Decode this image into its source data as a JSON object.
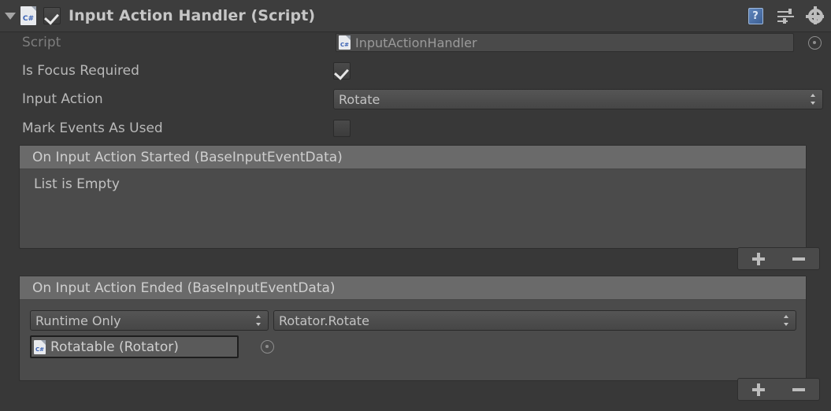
{
  "header": {
    "foldout_icon": "triangle-down-icon",
    "script_type_icon": "csharp-file-icon",
    "enabled": true,
    "title": "Input Action Handler (Script)",
    "icons": {
      "help": "help-book-icon",
      "presets": "preset-sliders-icon",
      "settings": "gear-icon",
      "help_glyph": "?"
    }
  },
  "properties": [
    {
      "label": "Script",
      "type": "object",
      "value": "InputActionHandler",
      "icon": "csharp-file-icon",
      "picker": "object-picker-icon",
      "disabled": true
    },
    {
      "label": "Is Focus Required",
      "type": "checkbox",
      "checked": true
    },
    {
      "label": "Input Action",
      "type": "dropdown",
      "value": "Rotate"
    },
    {
      "label": "Mark Events As Used",
      "type": "checkbox",
      "checked": false
    }
  ],
  "events": [
    {
      "title": "On Input Action Started (BaseInputEventData)",
      "empty_text": "List is Empty",
      "is_empty": true,
      "add_label": "+",
      "remove_label": "−"
    },
    {
      "title": "On Input Action Ended (BaseInputEventData)",
      "is_empty": false,
      "entry": {
        "mode": "Runtime Only",
        "function": "Rotator.Rotate",
        "target": "Rotatable (Rotator)",
        "target_icon": "csharp-file-icon",
        "picker": "object-picker-icon"
      },
      "add_label": "+",
      "remove_label": "−"
    }
  ],
  "colors": {
    "window_bg": "#383838",
    "header_bg": "#3d3d3d",
    "panel_bg": "#4b4b4b",
    "panel_header_bg": "#6a6a6a",
    "text": "#b8b8b8",
    "text_dim": "#7d7d7d",
    "accent_blue": "#3a62b5"
  },
  "glyphs": {
    "csharp": "C#"
  }
}
